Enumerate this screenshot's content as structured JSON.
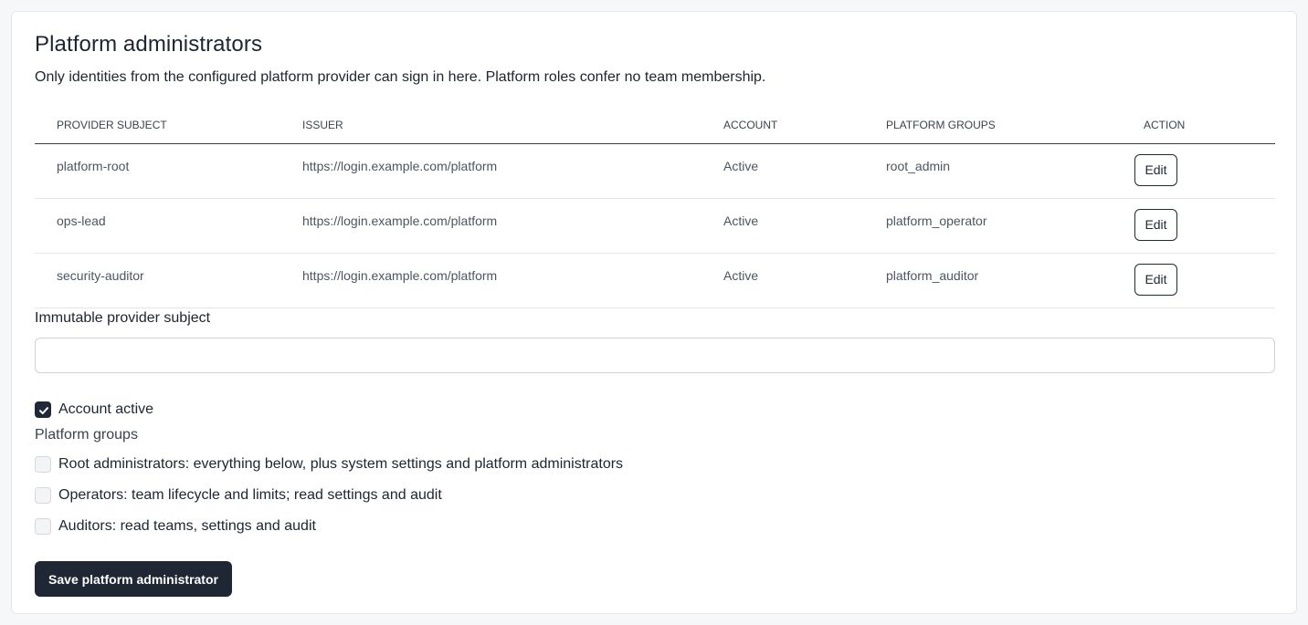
{
  "title": "Platform administrators",
  "description": "Only identities from the configured platform provider can sign in here. Platform roles confer no team membership.",
  "table": {
    "headers": [
      "PROVIDER SUBJECT",
      "ISSUER",
      "ACCOUNT",
      "PLATFORM GROUPS",
      "ACTION"
    ],
    "rows": [
      {
        "subject": "platform-root",
        "issuer": "https://login.example.com/platform",
        "account": "Active",
        "groups": "root_admin",
        "action": "Edit"
      },
      {
        "subject": "ops-lead",
        "issuer": "https://login.example.com/platform",
        "account": "Active",
        "groups": "platform_operator",
        "action": "Edit"
      },
      {
        "subject": "security-auditor",
        "issuer": "https://login.example.com/platform",
        "account": "Active",
        "groups": "platform_auditor",
        "action": "Edit"
      }
    ]
  },
  "form": {
    "subject_label": "Immutable provider subject",
    "subject_value": "",
    "account_active_label": "Account active",
    "account_active_checked": true,
    "groups_label": "Platform groups",
    "groups": [
      {
        "label": "Root administrators: everything below, plus system settings and platform administrators",
        "checked": false
      },
      {
        "label": "Operators: team lifecycle and limits; read settings and audit",
        "checked": false
      },
      {
        "label": "Auditors: read teams, settings and audit",
        "checked": false
      }
    ],
    "save_label": "Save platform administrator"
  },
  "icons": {
    "checkmark": "check-icon"
  },
  "colors": {
    "primary": "#1f2735",
    "border": "#cfd3d9"
  }
}
